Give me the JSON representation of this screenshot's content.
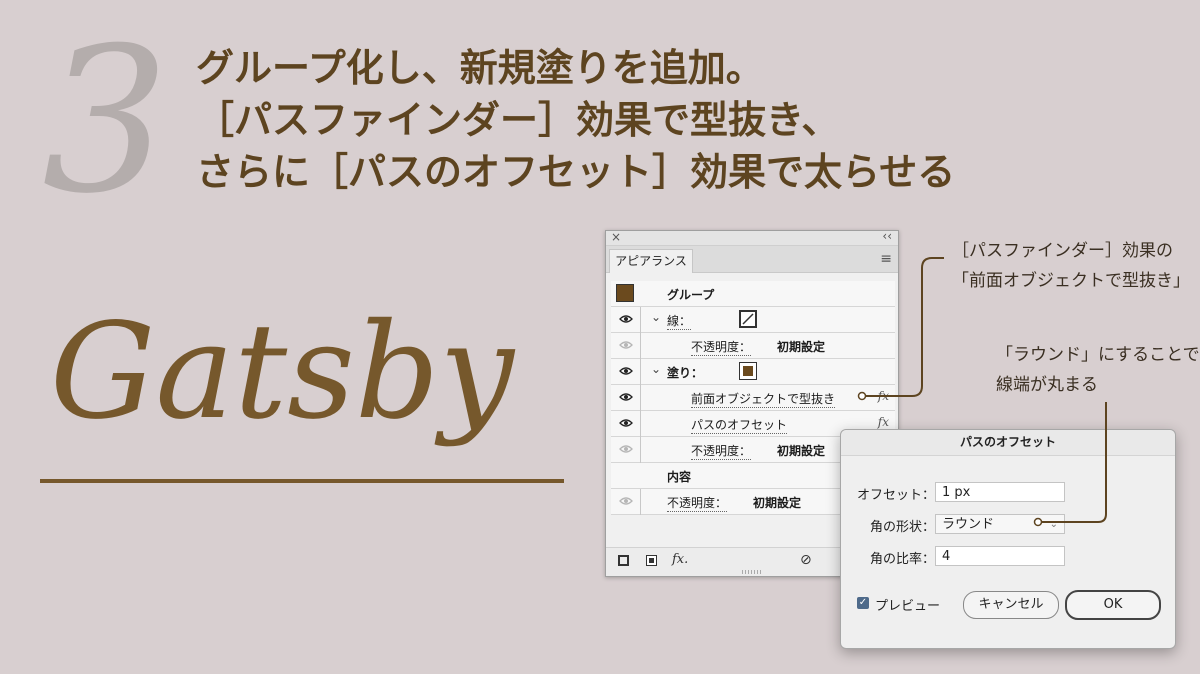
{
  "step": {
    "number": "3"
  },
  "headline": {
    "line1": "グループ化し、新規塗りを追加。",
    "line2": "［パスファインダー］効果で型抜き、",
    "line3": "さらに［パスのオフセット］効果で太らせる"
  },
  "sample": {
    "text": "Gatsby"
  },
  "appearance_panel": {
    "tab_label": "アピアランス",
    "rows": {
      "group": "グループ",
      "stroke": "線：",
      "stroke_opacity_label": "不透明度：",
      "stroke_opacity_value": "初期設定",
      "fill": "塗り：",
      "effect1": "前面オブジェクトで型抜き",
      "effect2": "パスのオフセット",
      "fill_opacity_label": "不透明度：",
      "fill_opacity_value": "初期設定",
      "contents": "内容",
      "opacity_label": "不透明度：",
      "opacity_value": "初期設定"
    },
    "fx": "fx",
    "footer_fx": "fx."
  },
  "offset_dialog": {
    "title": "パスのオフセット",
    "offset_label": "オフセット：",
    "offset_value": "1 px",
    "joins_label": "角の形状：",
    "joins_value": "ラウンド",
    "miter_label": "角の比率：",
    "miter_value": "4",
    "preview_label": "プレビュー",
    "preview_checked": true,
    "cancel_label": "キャンセル",
    "ok_label": "OK"
  },
  "annotations": {
    "note1_line1": "［パスファインダー］効果の",
    "note1_line2": "「前面オブジェクトで型抜き」",
    "note2_line1": "「ラウンド」にすることで、",
    "note2_line2": "線端が丸まる"
  },
  "colors": {
    "background": "#d8cfd0",
    "headline": "#5d4420",
    "sample": "#76582c",
    "swatch": "#6b4a1e"
  }
}
